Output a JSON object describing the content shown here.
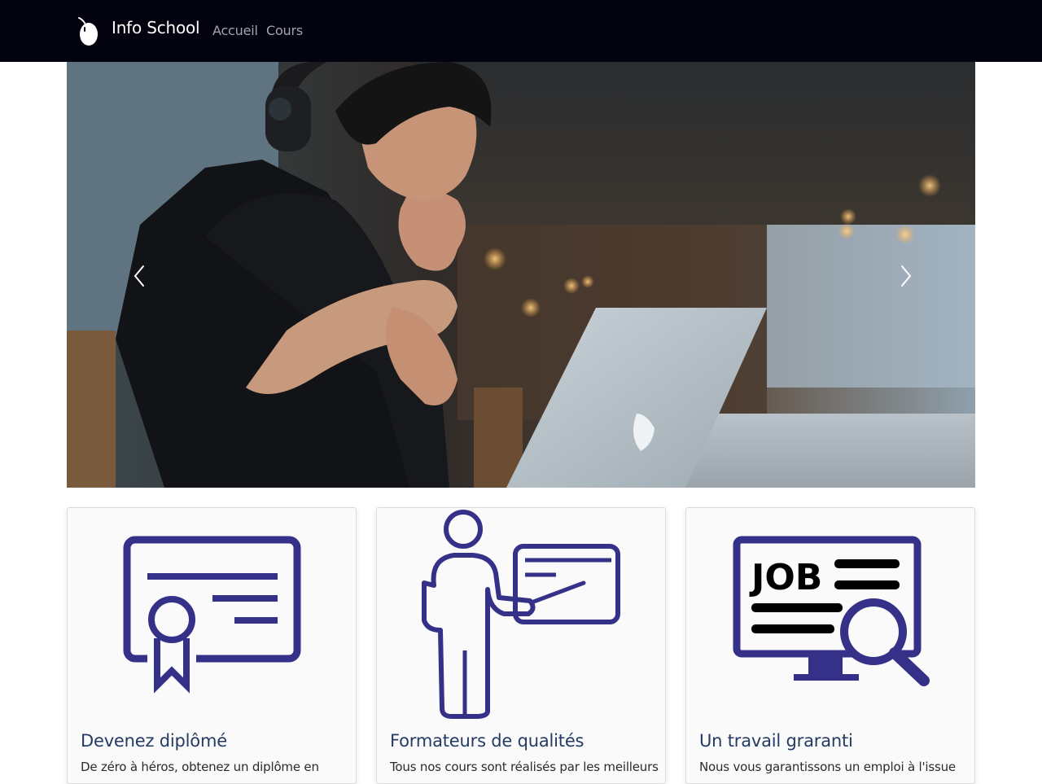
{
  "navbar": {
    "brand": "Info School",
    "links": [
      {
        "label": "Accueil"
      },
      {
        "label": "Cours"
      }
    ]
  },
  "carousel": {
    "prev_icon": "chevron-left-icon",
    "next_icon": "chevron-right-icon"
  },
  "cards": [
    {
      "icon": "diploma-icon",
      "title": "Devenez diplômé",
      "text": "De zéro à héros, obtenez un diplôme en"
    },
    {
      "icon": "teacher-icon",
      "title": "Formateurs de qualités",
      "text": "Tous nos cours sont réalisés par les meilleurs"
    },
    {
      "icon": "job-search-icon",
      "title": "Un travail graranti",
      "text": "Nous vous garantissons un emploi à l'issue"
    }
  ],
  "colors": {
    "navbar": "#03030f",
    "icon": "#363188",
    "card_title": "#243b63"
  }
}
